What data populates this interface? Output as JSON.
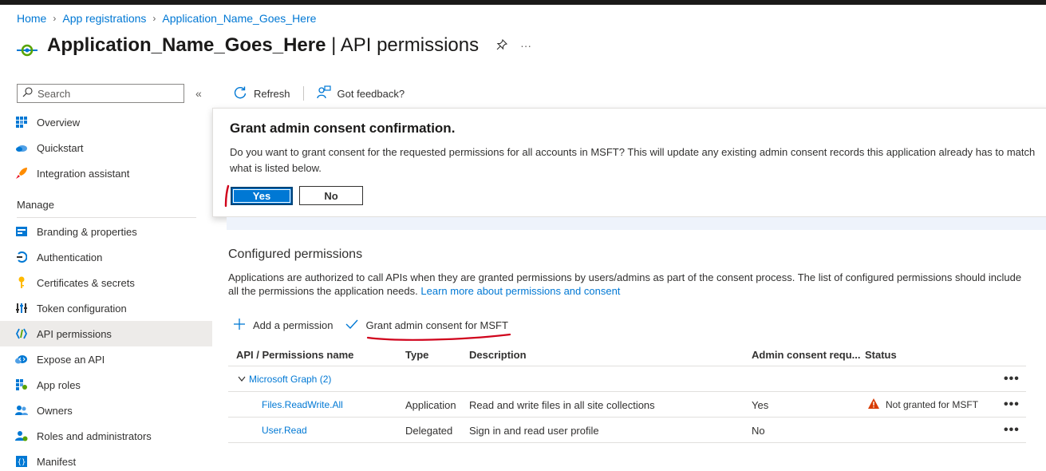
{
  "breadcrumb": {
    "items": [
      "Home",
      "App registrations",
      "Application_Name_Goes_Here"
    ]
  },
  "page": {
    "app_name": "Application_Name_Goes_Here",
    "title_suffix": " | API permissions",
    "pin_icon": "pin-icon",
    "more_icon": "ellipsis-icon"
  },
  "sidebar": {
    "search_placeholder": "Search",
    "collapse_label": "«",
    "section_manage": "Manage",
    "items": [
      {
        "label": "Overview",
        "icon": "grid-icon"
      },
      {
        "label": "Quickstart",
        "icon": "cloud-icon"
      },
      {
        "label": "Integration assistant",
        "icon": "rocket-icon"
      },
      {
        "label": "Branding & properties",
        "icon": "branding-icon"
      },
      {
        "label": "Authentication",
        "icon": "authentication-icon"
      },
      {
        "label": "Certificates & secrets",
        "icon": "key-icon"
      },
      {
        "label": "Token configuration",
        "icon": "token-icon"
      },
      {
        "label": "API permissions",
        "icon": "api-icon"
      },
      {
        "label": "Expose an API",
        "icon": "cloud-api-icon"
      },
      {
        "label": "App roles",
        "icon": "app-roles-icon"
      },
      {
        "label": "Owners",
        "icon": "owners-icon"
      },
      {
        "label": "Roles and administrators",
        "icon": "roles-icon"
      },
      {
        "label": "Manifest",
        "icon": "manifest-icon"
      }
    ]
  },
  "toolbar": {
    "refresh_label": "Refresh",
    "feedback_label": "Got feedback?"
  },
  "dialog": {
    "title": "Grant admin consent confirmation.",
    "message": "Do you want to grant consent for the requested permissions for all accounts in MSFT? This will update any existing admin consent records this application already has to match what is listed below.",
    "yes_label": "Yes",
    "no_label": "No"
  },
  "configured": {
    "title": "Configured permissions",
    "description": "Applications are authorized to call APIs when they are granted permissions by users/admins as part of the consent process. The list of configured permissions should include all the permissions the application needs. ",
    "learn_more": "Learn more about permissions and consent",
    "add_permission_label": "Add a permission",
    "grant_consent_label": "Grant admin consent for MSFT"
  },
  "table": {
    "headers": [
      "API / Permissions name",
      "Type",
      "Description",
      "Admin consent requ...",
      "Status"
    ],
    "group": {
      "label": "Microsoft Graph (2)"
    },
    "rows": [
      {
        "name": "Files.ReadWrite.All",
        "type": "Application",
        "description": "Read and write files in all site collections",
        "admin_consent": "Yes",
        "status": "Not granted for MSFT"
      },
      {
        "name": "User.Read",
        "type": "Delegated",
        "description": "Sign in and read user profile",
        "admin_consent": "No",
        "status": ""
      }
    ],
    "more_label": "•••"
  },
  "colors": {
    "accent": "#0078d4",
    "warning": "#d83b01",
    "annotation": "#d0021b"
  }
}
